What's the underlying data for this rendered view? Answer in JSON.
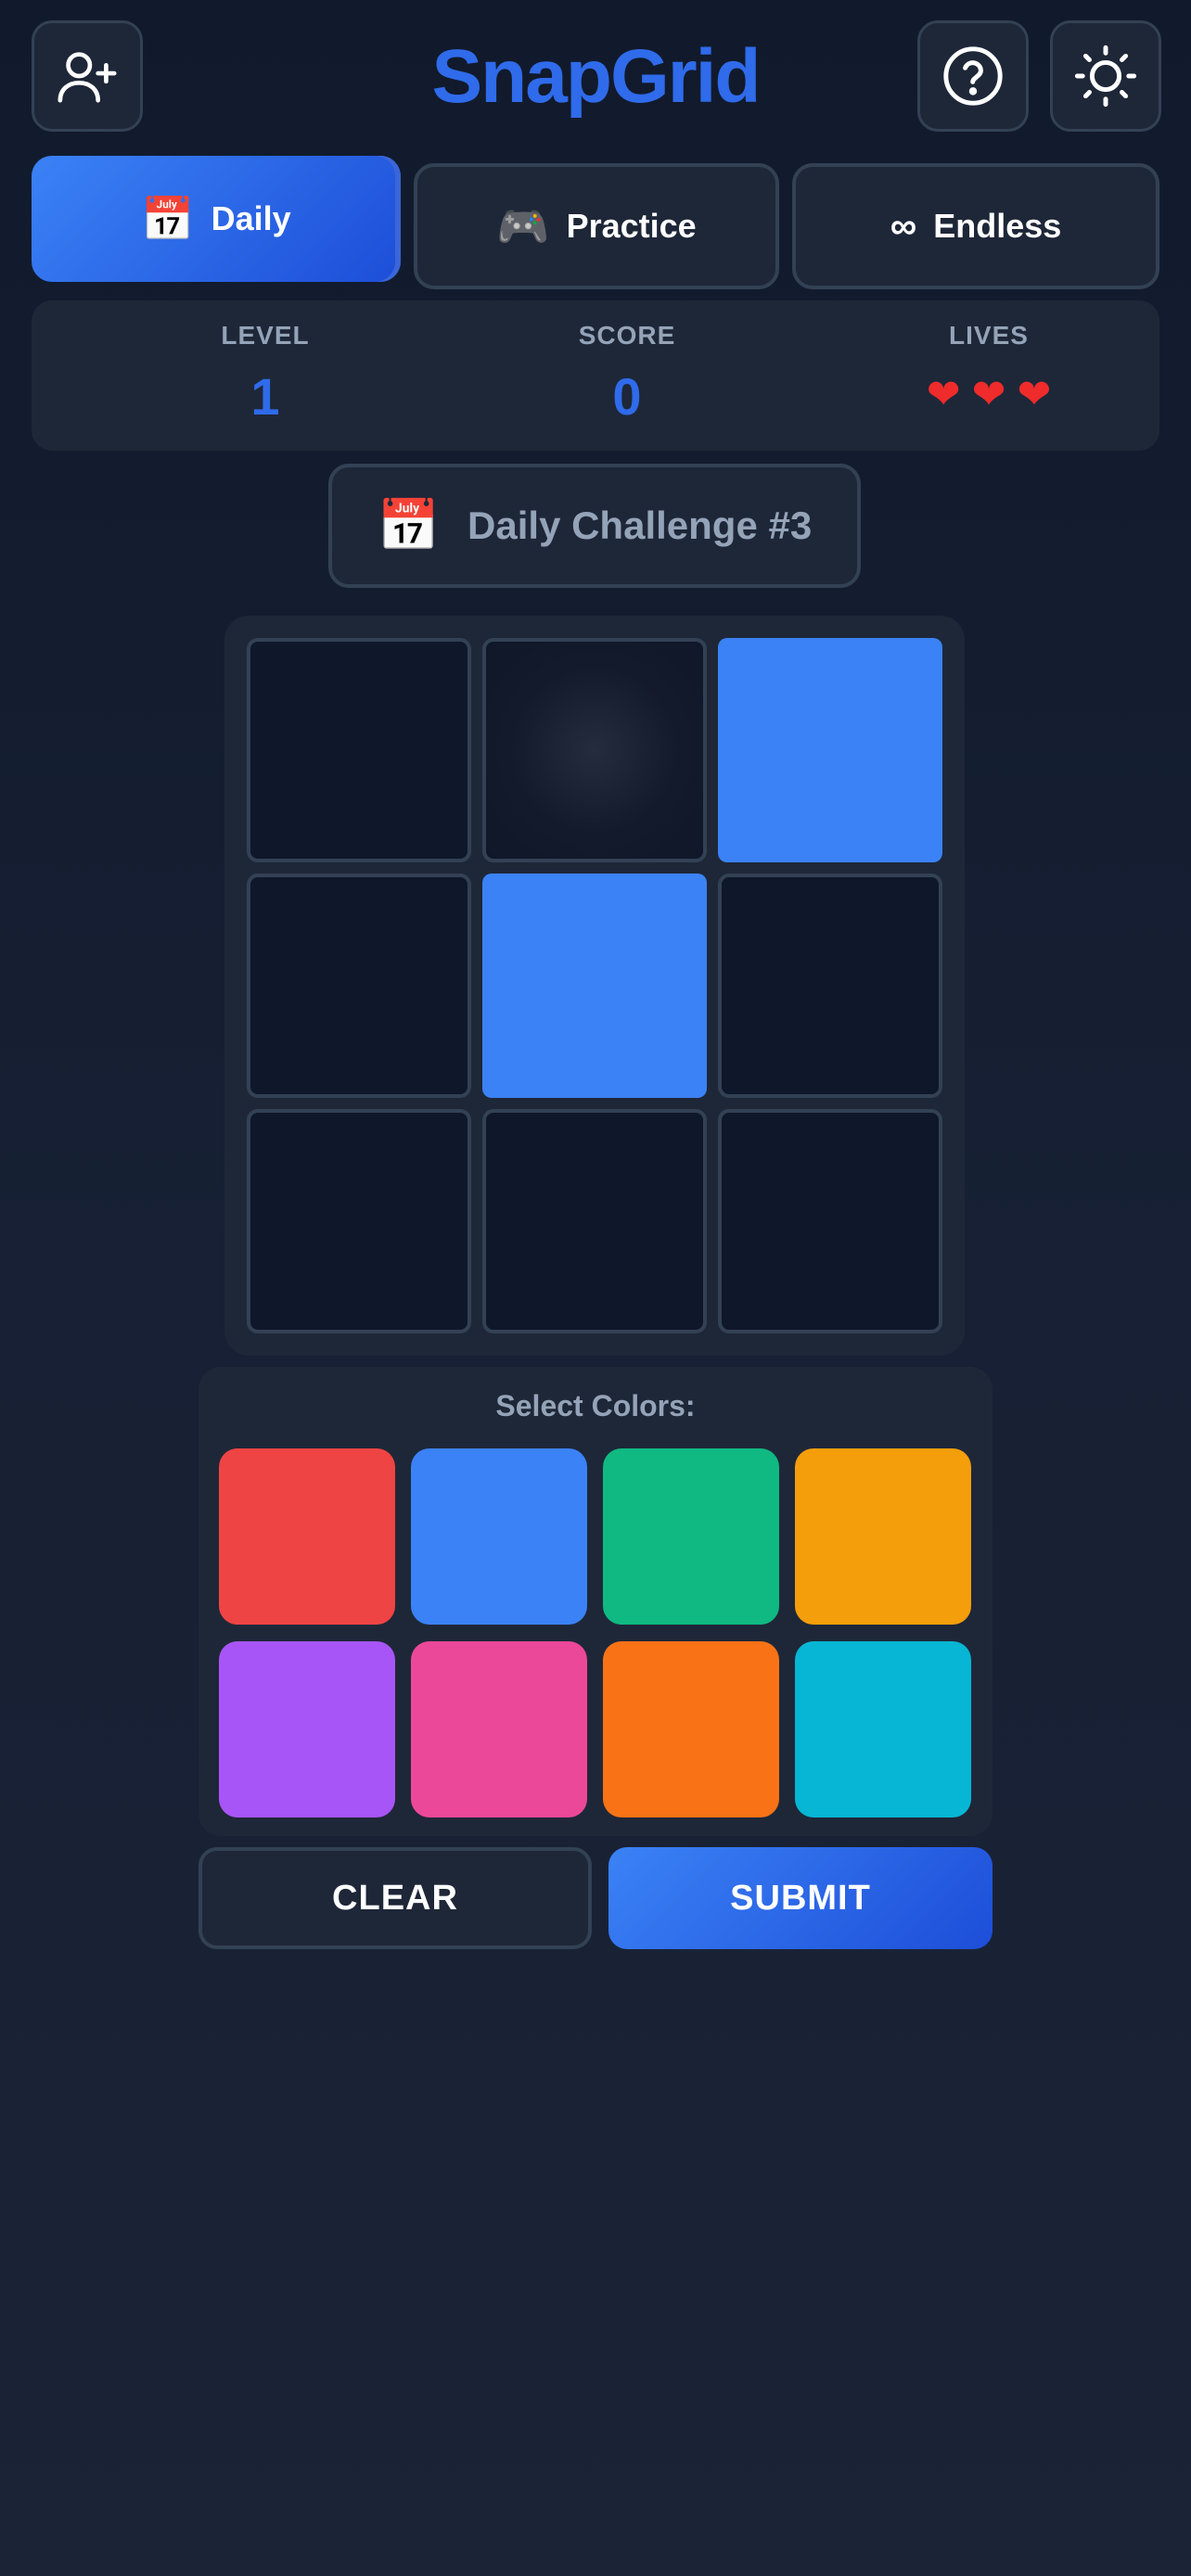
{
  "app": {
    "title": "SnapGrid"
  },
  "header": {
    "left_icon": "user-plus-icon",
    "right_icons": [
      "help-circle-icon",
      "sun-icon"
    ]
  },
  "tabs": [
    {
      "label": "Daily",
      "icon": "📅",
      "active": true
    },
    {
      "label": "Practice",
      "icon": "🎮",
      "active": false
    },
    {
      "label": "Endless",
      "icon": "∞",
      "active": false
    }
  ],
  "stats": {
    "level_label": "LEVEL",
    "level": "1",
    "score_label": "SCORE",
    "score": "0",
    "lives_label": "LIVES",
    "lives": 3
  },
  "challenge": {
    "icon": "📅",
    "label": "Daily Challenge #3"
  },
  "grid": {
    "rows": 3,
    "cols": 3,
    "cells": [
      "empty",
      "empty",
      "blue",
      "empty",
      "blue",
      "empty",
      "empty",
      "empty",
      "empty"
    ]
  },
  "palette": {
    "title": "Select Colors:",
    "colors": [
      {
        "name": "red",
        "hex": "#ef4444"
      },
      {
        "name": "blue",
        "hex": "#3b82f6"
      },
      {
        "name": "green",
        "hex": "#10b981"
      },
      {
        "name": "amber",
        "hex": "#f59e0b"
      },
      {
        "name": "purple",
        "hex": "#a855f7"
      },
      {
        "name": "pink",
        "hex": "#ec4899"
      },
      {
        "name": "orange",
        "hex": "#f97316"
      },
      {
        "name": "cyan",
        "hex": "#06b6d4"
      }
    ]
  },
  "actions": {
    "clear_label": "CLEAR",
    "submit_label": "SUBMIT"
  },
  "colors": {
    "accent": "#3b82f6",
    "panel": "#1e2738",
    "border": "#334155"
  }
}
